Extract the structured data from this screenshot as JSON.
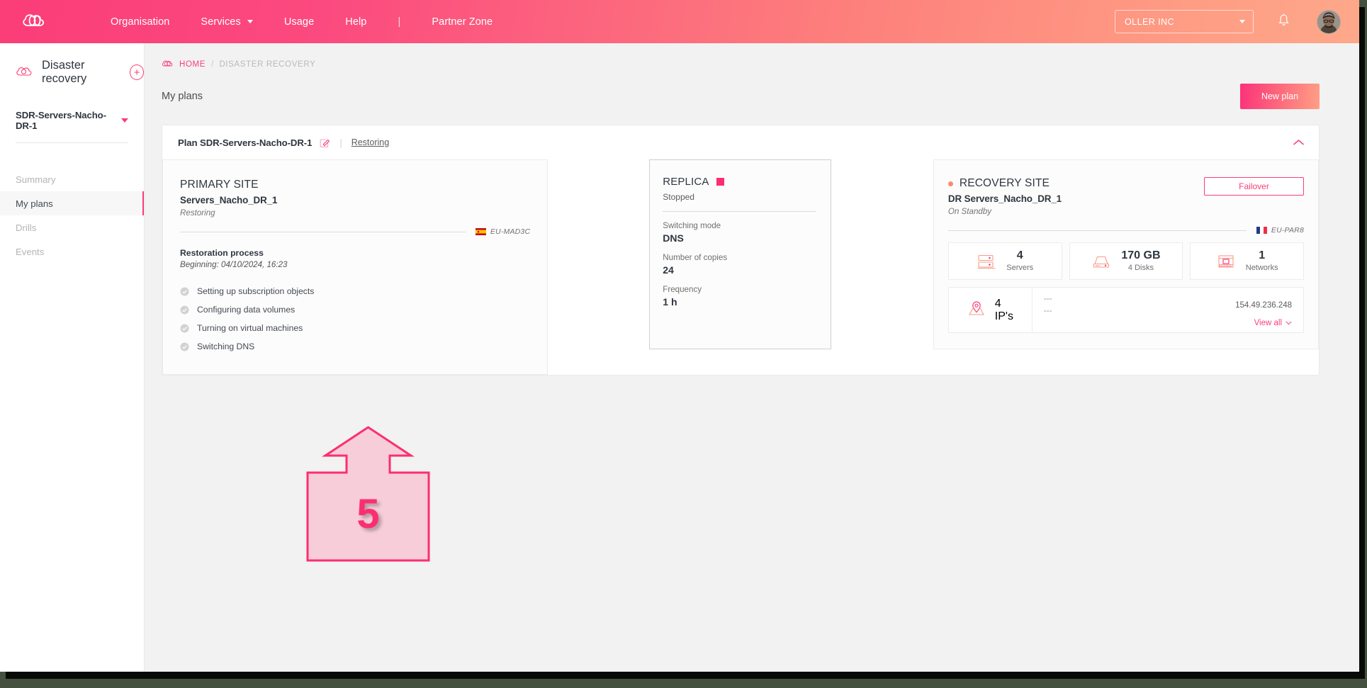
{
  "topbar": {
    "logo_icon": "cloud-logo-icon",
    "nav": [
      {
        "label": "Organisation",
        "has_caret": false
      },
      {
        "label": "Services",
        "has_caret": true
      },
      {
        "label": "Usage",
        "has_caret": false
      },
      {
        "label": "Help",
        "has_caret": false
      },
      {
        "label": "Partner Zone",
        "has_caret": false
      }
    ],
    "separator": "|",
    "org": "OLLER INC",
    "bell_icon": "notification-bell-icon",
    "avatar_icon": "user-avatar"
  },
  "sidebar": {
    "section_icon": "disaster-recovery-cloud-icon",
    "section_title": "Disaster recovery",
    "add_label": "+",
    "selected_plan": "SDR-Servers-Nacho-DR-1",
    "items": [
      {
        "label": "Summary",
        "active": false
      },
      {
        "label": "My plans",
        "active": true
      },
      {
        "label": "Drills",
        "active": false
      },
      {
        "label": "Events",
        "active": false
      }
    ]
  },
  "breadcrumb": {
    "icon": "cloud-home-icon",
    "home": "HOME",
    "separator": "/",
    "current": "DISASTER RECOVERY"
  },
  "page": {
    "title": "My plans",
    "new_plan_label": "New plan"
  },
  "plan": {
    "name": "Plan SDR-Servers-Nacho-DR-1",
    "edit_icon": "edit-pencil-icon",
    "divider": "|",
    "status": "Restoring",
    "collapse_icon": "chevron-up-icon"
  },
  "primary_site": {
    "title": "PRIMARY SITE",
    "name": "Servers_Nacho_DR_1",
    "state": "Restoring",
    "region_flag": "flag-spain",
    "region": "EU-MAD3C",
    "process_title": "Restoration process",
    "process_date": "Beginning: 04/10/2024, 16:23",
    "steps": [
      {
        "label": "Setting up subscription objects",
        "icon": "check-circle-icon"
      },
      {
        "label": "Configuring data volumes",
        "icon": "check-circle-icon"
      },
      {
        "label": "Turning on virtual machines",
        "icon": "check-circle-icon"
      },
      {
        "label": "Switching DNS",
        "icon": "check-circle-icon"
      }
    ]
  },
  "replica": {
    "title": "REPLICA",
    "status_color": "#fb2f6f",
    "state": "Stopped",
    "fields": [
      {
        "key": "Switching mode",
        "value": "DNS"
      },
      {
        "key": "Number of copies",
        "value": "24"
      },
      {
        "key": "Frequency",
        "value": "1 h"
      }
    ]
  },
  "recovery_site": {
    "status_dot_color": "#fd8a6e",
    "title": "RECOVERY SITE",
    "name": "DR Servers_Nacho_DR_1",
    "state": "On Standby",
    "failover_label": "Failover",
    "region_flag": "flag-france",
    "region": "EU-PAR8",
    "tiles": [
      {
        "icon": "servers-icon",
        "value": "4",
        "caption": "Servers"
      },
      {
        "icon": "disk-icon",
        "value": "170 GB",
        "caption": "4 Disks"
      },
      {
        "icon": "network-icon",
        "value": "1",
        "caption": "Networks"
      }
    ],
    "ip_tile": {
      "icon": "location-pin-icon",
      "value": "4",
      "caption": "IP's",
      "dash1": "---",
      "dash2": "---",
      "ip": "154.49.236.248",
      "view_all": "View all",
      "view_all_icon": "chevron-down-icon"
    }
  },
  "annotation": {
    "number": "5",
    "shape": "up-arrow-callout",
    "stroke": "#fb2f6f",
    "fill": "#f8cdda"
  }
}
